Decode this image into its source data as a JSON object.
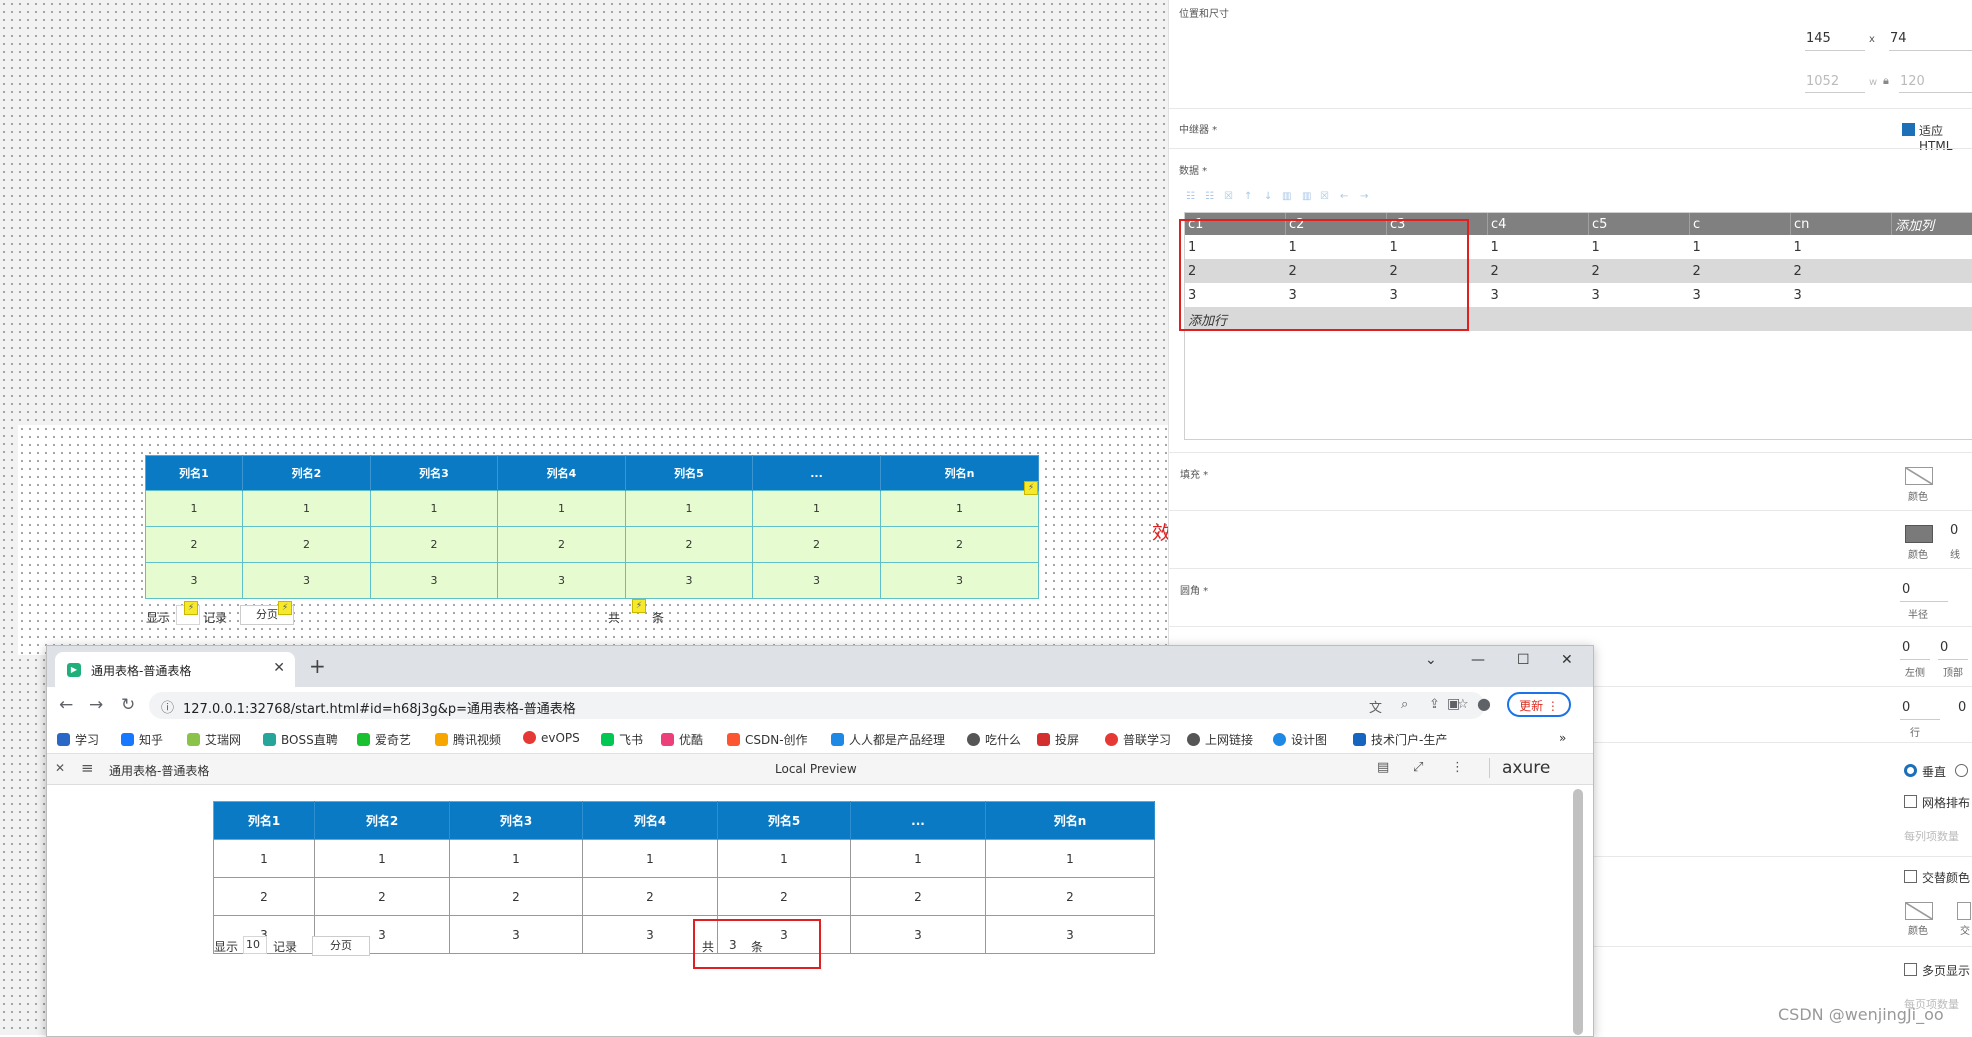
{
  "canvas": {
    "design_table": {
      "headers": [
        "列名1",
        "列名2",
        "列名3",
        "列名4",
        "列名5",
        "...",
        "列名n"
      ],
      "rows": [
        [
          "1",
          "1",
          "1",
          "1",
          "1",
          "1",
          "1"
        ],
        [
          "2",
          "2",
          "2",
          "2",
          "2",
          "2",
          "2"
        ],
        [
          "3",
          "3",
          "3",
          "3",
          "3",
          "3",
          "3"
        ]
      ]
    },
    "pager": {
      "show_label": "显示",
      "record_label": "记录",
      "page_button": "分页",
      "total_prefix": "共",
      "total_suffix": "条"
    },
    "annotation": "效果图"
  },
  "panel": {
    "section_position": "位置和尺寸",
    "x_value": "145",
    "x_sep": "x",
    "y_value": "74",
    "w_value": "1052",
    "w_sep": "w",
    "h_value": "120",
    "repeater_label": "中继器 *",
    "fit_html_label": "适应HTML",
    "data_label": "数据 *",
    "data_grid": {
      "columns": [
        "c1",
        "c2",
        "c3",
        "c4",
        "c5",
        "c",
        "cn"
      ],
      "add_column": "添加列",
      "rows": [
        [
          "1",
          "1",
          "1",
          "1",
          "1",
          "1",
          "1"
        ],
        [
          "2",
          "2",
          "2",
          "2",
          "2",
          "2",
          "2"
        ],
        [
          "3",
          "3",
          "3",
          "3",
          "3",
          "3",
          "3"
        ]
      ],
      "add_row": "添加行"
    },
    "fill_label": "填充 *",
    "color_label": "颜色",
    "border_value": "0",
    "line_label": "线",
    "corner_label": "圆角 *",
    "corner_value": "0",
    "radius_label": "半径",
    "left_value": "0",
    "top_value": "0",
    "left_label": "左侧",
    "top_label": "顶部",
    "row_value": "0",
    "row_value2": "0",
    "row_label": "行",
    "vertical_label": "垂直",
    "grid_layout_label": "网格排布",
    "per_col_label": "每列项数量",
    "alt_color_label": "交替颜色",
    "alt_color_color_label": "颜色",
    "alt_short": "交",
    "multipage_label": "多页显示",
    "per_page_label": "每页项数量"
  },
  "browser": {
    "tab_title": "通用表格-普通表格",
    "url": "127.0.0.1:32768/start.html#id=h68j3g&p=通用表格-普通表格",
    "update_label": "更新",
    "bookmarks": [
      {
        "label": "学习",
        "icon": "bing-icon",
        "color": "#2b67c6"
      },
      {
        "label": "知乎",
        "icon": "zhihu-icon",
        "color": "#1677ff"
      },
      {
        "label": "艾瑞网",
        "icon": "iresearch-icon",
        "color": "#8bc34a"
      },
      {
        "label": "BOSS直聘",
        "icon": "boss-icon",
        "color": "#26a69a"
      },
      {
        "label": "爱奇艺",
        "icon": "iqiyi-icon",
        "color": "#19c12f"
      },
      {
        "label": "腾讯视频",
        "icon": "tencent-video-icon",
        "color": "#f7a600"
      },
      {
        "label": "evOPS",
        "icon": "evops-icon",
        "color": "#e53935"
      },
      {
        "label": "飞书",
        "icon": "feishu-icon",
        "color": "#00c853"
      },
      {
        "label": "优酷",
        "icon": "youku-icon",
        "color": "#ec407a"
      },
      {
        "label": "CSDN-创作",
        "icon": "csdn-icon",
        "color": "#fc5531"
      },
      {
        "label": "人人都是产品经理",
        "icon": "woshipm-icon",
        "color": "#1e88e5"
      },
      {
        "label": "吃什么",
        "icon": "globe-icon",
        "color": "#555555"
      },
      {
        "label": "投屏",
        "icon": "hac-icon",
        "color": "#d32f2f"
      },
      {
        "label": "普联学习",
        "icon": "tplink-icon",
        "color": "#e53935"
      },
      {
        "label": "上网链接",
        "icon": "globe-icon",
        "color": "#555555"
      },
      {
        "label": "设计图",
        "icon": "shield-icon",
        "color": "#1e88e5"
      },
      {
        "label": "技术门户-生产",
        "icon": "portal-icon",
        "color": "#1565c0"
      }
    ],
    "axure_page_title": "通用表格-普通表格",
    "local_preview": "Local Preview",
    "axure_logo": "axure",
    "preview_table": {
      "headers": [
        "列名1",
        "列名2",
        "列名3",
        "列名4",
        "列名5",
        "...",
        "列名n"
      ],
      "rows": [
        [
          "1",
          "1",
          "1",
          "1",
          "1",
          "1",
          "1"
        ],
        [
          "2",
          "2",
          "2",
          "2",
          "2",
          "2",
          "2"
        ],
        [
          "3",
          "3",
          "3",
          "3",
          "3",
          "3",
          "3"
        ]
      ]
    },
    "pager": {
      "show_label": "显示",
      "page_size": "10",
      "record_label": "记录",
      "page_button": "分页",
      "total_prefix": "共",
      "total_count": "3",
      "total_suffix": "条"
    }
  },
  "watermark": "CSDN @wenjingJi_oo",
  "colors": {
    "table_header": "#0a7ac4",
    "design_cell": "#e6fbd0",
    "highlight_box": "#e02020",
    "grid_header": "#808080"
  }
}
